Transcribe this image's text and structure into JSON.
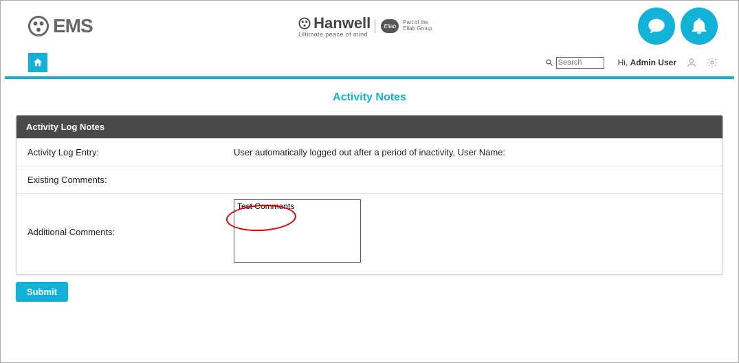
{
  "brand": {
    "left_text": "EMS",
    "center_main": "Hanwell",
    "center_sub": "Ultimate peace of mind",
    "ellab_badge": "Ellab",
    "ellab_line1": "Part of the",
    "ellab_line2": "Ellab Group"
  },
  "toolbar": {
    "search_placeholder": "Search",
    "greeting_prefix": "Hi,",
    "username": "Admin User"
  },
  "page": {
    "title": "Activity Notes"
  },
  "panel": {
    "header": "Activity Log Notes",
    "rows": {
      "entry_label": "Activity Log Entry:",
      "entry_value": "User automatically logged out after a period of inactivity, User Name:",
      "existing_label": "Existing Comments:",
      "existing_value": "",
      "additional_label": "Additional Comments:",
      "additional_value": "Test Comments"
    }
  },
  "actions": {
    "submit": "Submit"
  }
}
